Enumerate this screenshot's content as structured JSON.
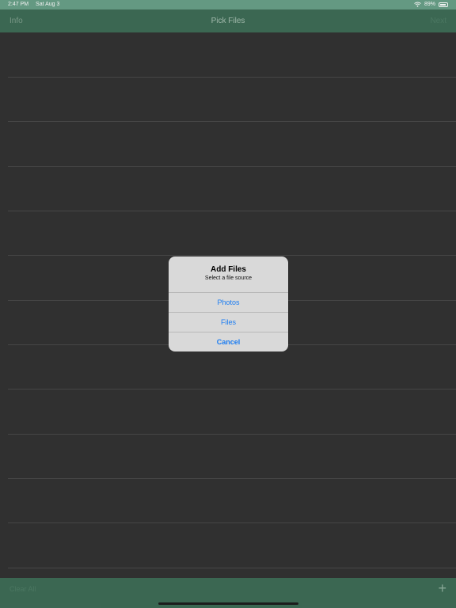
{
  "status_bar": {
    "time": "2:47 PM",
    "date": "Sat Aug 3",
    "battery": "89%"
  },
  "nav": {
    "left_label": "Info",
    "title": "Pick Files",
    "right_label": "Next"
  },
  "alert": {
    "title": "Add Files",
    "message": "Select a file source",
    "buttons": [
      "Photos",
      "Files",
      "Cancel"
    ]
  },
  "toolbar": {
    "left_label": "Clear All",
    "add_icon": "plus-icon"
  },
  "colors": {
    "status_bar": "#6aa28a",
    "nav_bar": "#3f6d57",
    "background": "#333333",
    "alert_button": "#1a7cf2"
  }
}
